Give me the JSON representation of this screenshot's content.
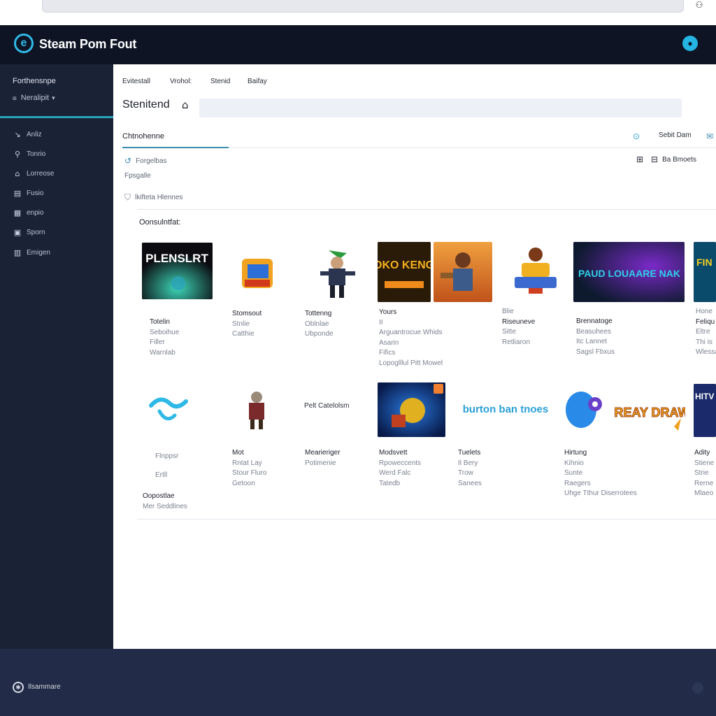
{
  "browser": {
    "user_icon": "user-icon"
  },
  "header": {
    "title": "Steam Pom Fout",
    "logo_glyph": "e",
    "badge_icon": "profile-icon"
  },
  "sidebar": {
    "section_title": "Forthensnpe",
    "dropdown": "Neralipit",
    "items": [
      {
        "label": "Anliz",
        "icon": "chart-icon",
        "glyph": "↘"
      },
      {
        "label": "Tonrio",
        "icon": "network-icon",
        "glyph": "⚲"
      },
      {
        "label": "Lorreose",
        "icon": "cart-icon",
        "glyph": "⌂"
      },
      {
        "label": "Fusio",
        "icon": "document-icon",
        "glyph": "▤"
      },
      {
        "label": "enpio",
        "icon": "grid-icon",
        "glyph": "▦"
      },
      {
        "label": "Sporn",
        "icon": "video-icon",
        "glyph": "▣"
      },
      {
        "label": "Emigen",
        "icon": "table-icon",
        "glyph": "▥"
      }
    ]
  },
  "top_tabs": [
    "Evitestall",
    "Vrohol:",
    "Stenid",
    "Baifay"
  ],
  "page_title": "Stenitend",
  "search": {
    "placeholder": "",
    "value": ""
  },
  "section_tab": "Chtnohenne",
  "toolbar": {
    "share_label": "Sebit Dam",
    "filter_label": "Ba Bmoets"
  },
  "filters": [
    {
      "label": "Forgelbas",
      "icon": "refresh-icon"
    },
    {
      "label": "Fpsgalle",
      "icon": ""
    },
    {
      "label": "lkifteta Hlennes",
      "icon": "badge-icon"
    }
  ],
  "grid_title": "Oonsulntfat:",
  "games_row1": [
    {
      "cover": "PLENSLRT",
      "lines": [
        "Totelin",
        "Seboihue",
        "Filler",
        "Warnlab"
      ]
    },
    {
      "cover": "",
      "lines": [
        "Stomsout",
        "Stnlie",
        "Catthie"
      ]
    },
    {
      "cover": "",
      "lines": [
        "Tottenng",
        "Oblnlae",
        "Ubponde"
      ]
    },
    {
      "cover": "FOKO KENGY",
      "lines": [
        "Yours",
        "II",
        "Arguantrocue Whids",
        "Asarin",
        "Fifics",
        "Lopoglllul Pitt Mowel"
      ]
    },
    {
      "cover": "",
      "lines": [
        "Blie",
        "Riseuneve",
        "Sitte",
        "Retliaron"
      ]
    },
    {
      "cover": "PAUD LOUAARE NAK",
      "lines": [
        "Brennatoge",
        "Beasuhees",
        "Itc Lannet",
        "Sagsl Fbxus"
      ]
    },
    {
      "cover": "FIN",
      "lines": [
        "Hone",
        "Feliqu",
        "Eltre",
        "Thi is",
        "Wlessa"
      ]
    }
  ],
  "games_row2": [
    {
      "cover": "",
      "lines": [
        "Flnppsr",
        "Ertll"
      ],
      "extra": [
        "Oopostlae",
        "Mer Seddlines"
      ]
    },
    {
      "cover": "",
      "lines": [
        "Mot",
        "Rntat Lay",
        "Stour Fluro",
        "Getoon"
      ]
    },
    {
      "cover": "Pelt Catelolsm",
      "lines": [
        "Mearieriger",
        "Potimenie"
      ]
    },
    {
      "cover": "",
      "lines": [
        "Modsvett",
        "Rpoweccents",
        "Werd Falc",
        "Tatedb"
      ]
    },
    {
      "cover": "burton ban tnoes",
      "lines": [
        "Tuelets",
        "Il Bery",
        "Trow",
        "Sanees"
      ]
    },
    {
      "cover": "CREAY DRAW",
      "lines": [
        "Hirtung",
        "Kihnio",
        "Sunte",
        "Raegers",
        "Uhge Tthur Diserrotees"
      ]
    },
    {
      "cover": "HITV",
      "lines": [
        "Adity",
        "Stiene",
        "Strie",
        "Rerne",
        "Mlaeo"
      ]
    }
  ],
  "footer": {
    "label": "Ilsammare"
  },
  "colors": {
    "accent": "#2fb9e6",
    "header_bg": "#0e1424",
    "sidebar_bg": "#1a2236",
    "footer_bg": "#222b47"
  }
}
